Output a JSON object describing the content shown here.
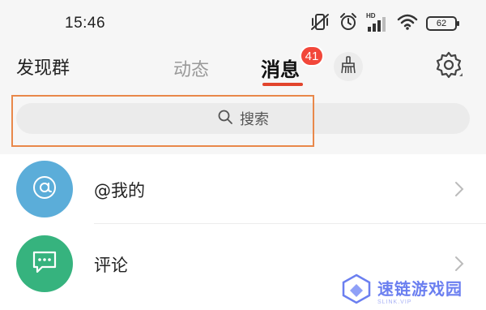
{
  "status_bar": {
    "time": "15:46",
    "icons": [
      "mute-vibrate-icon",
      "alarm-icon",
      "hd-signal-icon",
      "wifi-icon",
      "battery-icon"
    ],
    "hd_label": "HD",
    "battery_level": "62"
  },
  "nav": {
    "left_title": "发现群",
    "tabs": [
      {
        "label": "动态",
        "active": false
      },
      {
        "label": "消息",
        "active": true,
        "badge": "41"
      }
    ],
    "accent_color": "#e2442c",
    "badge_color": "#f2473a"
  },
  "search": {
    "placeholder": "搜索",
    "highlight_color": "#e9884a"
  },
  "list": [
    {
      "label": "@我的",
      "icon": "at-icon",
      "color": "#5badd9"
    },
    {
      "label": "评论",
      "icon": "comment-icon",
      "color": "#36b37e"
    }
  ],
  "watermark": {
    "text": "速链游戏园",
    "sub": "SLINK.VIP"
  }
}
